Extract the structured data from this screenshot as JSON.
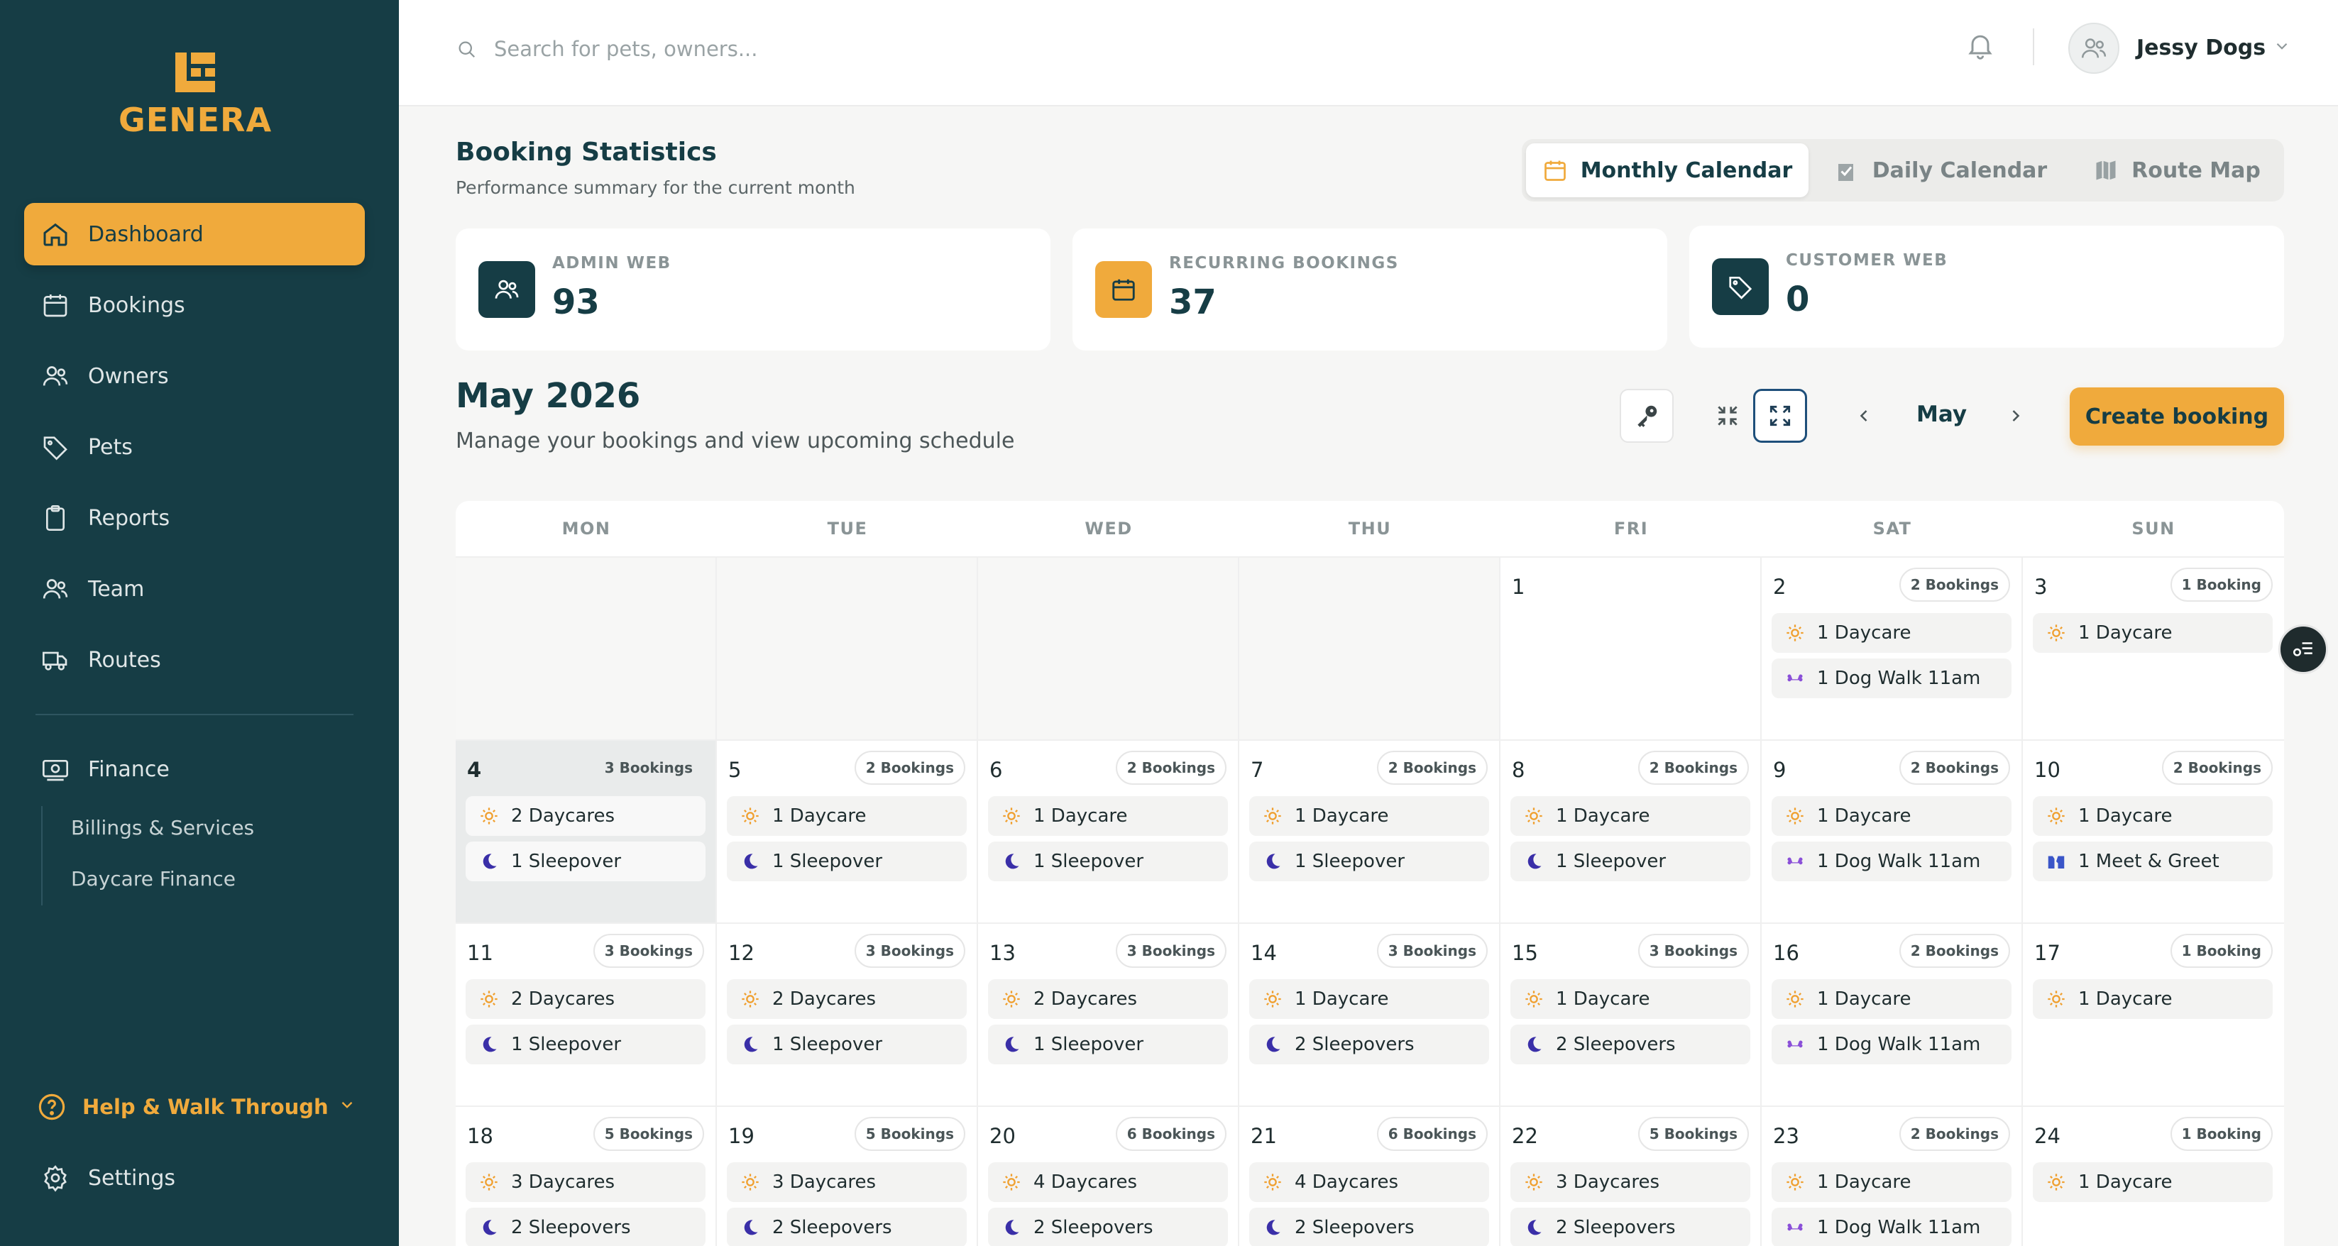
{
  "brand": {
    "name": "GENERA"
  },
  "sidebar": {
    "items": [
      {
        "label": "Dashboard",
        "icon": "home-icon",
        "active": true
      },
      {
        "label": "Bookings",
        "icon": "calendar-icon"
      },
      {
        "label": "Owners",
        "icon": "users-icon"
      },
      {
        "label": "Pets",
        "icon": "tag-icon"
      },
      {
        "label": "Reports",
        "icon": "clipboard-icon"
      },
      {
        "label": "Team",
        "icon": "team-icon"
      },
      {
        "label": "Routes",
        "icon": "truck-icon"
      }
    ],
    "finance": {
      "label": "Finance",
      "icon": "finance-icon",
      "children": [
        "Billings & Services",
        "Daycare Finance"
      ]
    },
    "help": "Help & Walk Through",
    "settings": "Settings"
  },
  "topbar": {
    "search_placeholder": "Search for pets, owners...",
    "user_name": "Jessy Dogs"
  },
  "header": {
    "title": "Booking Statistics",
    "subtitle": "Performance summary for the current month"
  },
  "view_toggle": [
    "Monthly Calendar",
    "Daily Calendar",
    "Route Map"
  ],
  "stats": [
    {
      "label": "ADMIN WEB",
      "value": "93"
    },
    {
      "label": "RECURRING BOOKINGS",
      "value": "37"
    },
    {
      "label": "CUSTOMER WEB",
      "value": "0"
    }
  ],
  "calendar": {
    "title": "May 2026",
    "subtitle": "Manage your bookings and view upcoming schedule",
    "month": "May",
    "create_label": "Create booking",
    "weekdays": [
      "MON",
      "TUE",
      "WED",
      "THU",
      "FRI",
      "SAT",
      "SUN"
    ],
    "colors": {
      "primary": "#163d45",
      "accent": "#f0aa3c",
      "daycare": "#f0a030",
      "sleepover": "#3a2fa8",
      "walk": "#8a4fd8",
      "meet": "#3a55c8"
    },
    "weeks": [
      [
        null,
        null,
        null,
        null,
        {
          "day": "1",
          "badge": "",
          "events": []
        },
        {
          "day": "2",
          "badge": "2 Bookings",
          "events": [
            {
              "type": "daycare",
              "label": "1 Daycare"
            },
            {
              "type": "walk",
              "label": "1 Dog Walk 11am"
            }
          ]
        },
        {
          "day": "3",
          "badge": "1 Booking",
          "events": [
            {
              "type": "daycare",
              "label": "1 Daycare"
            }
          ]
        }
      ],
      [
        {
          "day": "4",
          "badge": "3 Bookings",
          "today": true,
          "events": [
            {
              "type": "daycare",
              "label": "2 Daycares"
            },
            {
              "type": "sleepover",
              "label": "1 Sleepover"
            }
          ]
        },
        {
          "day": "5",
          "badge": "2 Bookings",
          "events": [
            {
              "type": "daycare",
              "label": "1 Daycare"
            },
            {
              "type": "sleepover",
              "label": "1 Sleepover"
            }
          ]
        },
        {
          "day": "6",
          "badge": "2 Bookings",
          "events": [
            {
              "type": "daycare",
              "label": "1 Daycare"
            },
            {
              "type": "sleepover",
              "label": "1 Sleepover"
            }
          ]
        },
        {
          "day": "7",
          "badge": "2 Bookings",
          "events": [
            {
              "type": "daycare",
              "label": "1 Daycare"
            },
            {
              "type": "sleepover",
              "label": "1 Sleepover"
            }
          ]
        },
        {
          "day": "8",
          "badge": "2 Bookings",
          "events": [
            {
              "type": "daycare",
              "label": "1 Daycare"
            },
            {
              "type": "sleepover",
              "label": "1 Sleepover"
            }
          ]
        },
        {
          "day": "9",
          "badge": "2 Bookings",
          "events": [
            {
              "type": "daycare",
              "label": "1 Daycare"
            },
            {
              "type": "walk",
              "label": "1 Dog Walk 11am"
            }
          ]
        },
        {
          "day": "10",
          "badge": "2 Bookings",
          "events": [
            {
              "type": "daycare",
              "label": "1 Daycare"
            },
            {
              "type": "meet",
              "label": "1 Meet & Greet"
            }
          ]
        }
      ],
      [
        {
          "day": "11",
          "badge": "3 Bookings",
          "events": [
            {
              "type": "daycare",
              "label": "2 Daycares"
            },
            {
              "type": "sleepover",
              "label": "1 Sleepover"
            }
          ]
        },
        {
          "day": "12",
          "badge": "3 Bookings",
          "events": [
            {
              "type": "daycare",
              "label": "2 Daycares"
            },
            {
              "type": "sleepover",
              "label": "1 Sleepover"
            }
          ]
        },
        {
          "day": "13",
          "badge": "3 Bookings",
          "events": [
            {
              "type": "daycare",
              "label": "2 Daycares"
            },
            {
              "type": "sleepover",
              "label": "1 Sleepover"
            }
          ]
        },
        {
          "day": "14",
          "badge": "3 Bookings",
          "events": [
            {
              "type": "daycare",
              "label": "1 Daycare"
            },
            {
              "type": "sleepover",
              "label": "2 Sleepovers"
            }
          ]
        },
        {
          "day": "15",
          "badge": "3 Bookings",
          "events": [
            {
              "type": "daycare",
              "label": "1 Daycare"
            },
            {
              "type": "sleepover",
              "label": "2 Sleepovers"
            }
          ]
        },
        {
          "day": "16",
          "badge": "2 Bookings",
          "events": [
            {
              "type": "daycare",
              "label": "1 Daycare"
            },
            {
              "type": "walk",
              "label": "1 Dog Walk 11am"
            }
          ]
        },
        {
          "day": "17",
          "badge": "1 Booking",
          "events": [
            {
              "type": "daycare",
              "label": "1 Daycare"
            }
          ]
        }
      ],
      [
        {
          "day": "18",
          "badge": "5 Bookings",
          "events": [
            {
              "type": "daycare",
              "label": "3 Daycares"
            },
            {
              "type": "sleepover",
              "label": "2 Sleepovers"
            }
          ]
        },
        {
          "day": "19",
          "badge": "5 Bookings",
          "events": [
            {
              "type": "daycare",
              "label": "3 Daycares"
            },
            {
              "type": "sleepover",
              "label": "2 Sleepovers"
            }
          ]
        },
        {
          "day": "20",
          "badge": "6 Bookings",
          "events": [
            {
              "type": "daycare",
              "label": "4 Daycares"
            },
            {
              "type": "sleepover",
              "label": "2 Sleepovers"
            }
          ]
        },
        {
          "day": "21",
          "badge": "6 Bookings",
          "events": [
            {
              "type": "daycare",
              "label": "4 Daycares"
            },
            {
              "type": "sleepover",
              "label": "2 Sleepovers"
            }
          ]
        },
        {
          "day": "22",
          "badge": "5 Bookings",
          "events": [
            {
              "type": "daycare",
              "label": "3 Daycares"
            },
            {
              "type": "sleepover",
              "label": "2 Sleepovers"
            }
          ]
        },
        {
          "day": "23",
          "badge": "2 Bookings",
          "events": [
            {
              "type": "daycare",
              "label": "1 Daycare"
            },
            {
              "type": "walk",
              "label": "1 Dog Walk 11am"
            }
          ]
        },
        {
          "day": "24",
          "badge": "1 Booking",
          "events": [
            {
              "type": "daycare",
              "label": "1 Daycare"
            }
          ]
        }
      ]
    ]
  }
}
